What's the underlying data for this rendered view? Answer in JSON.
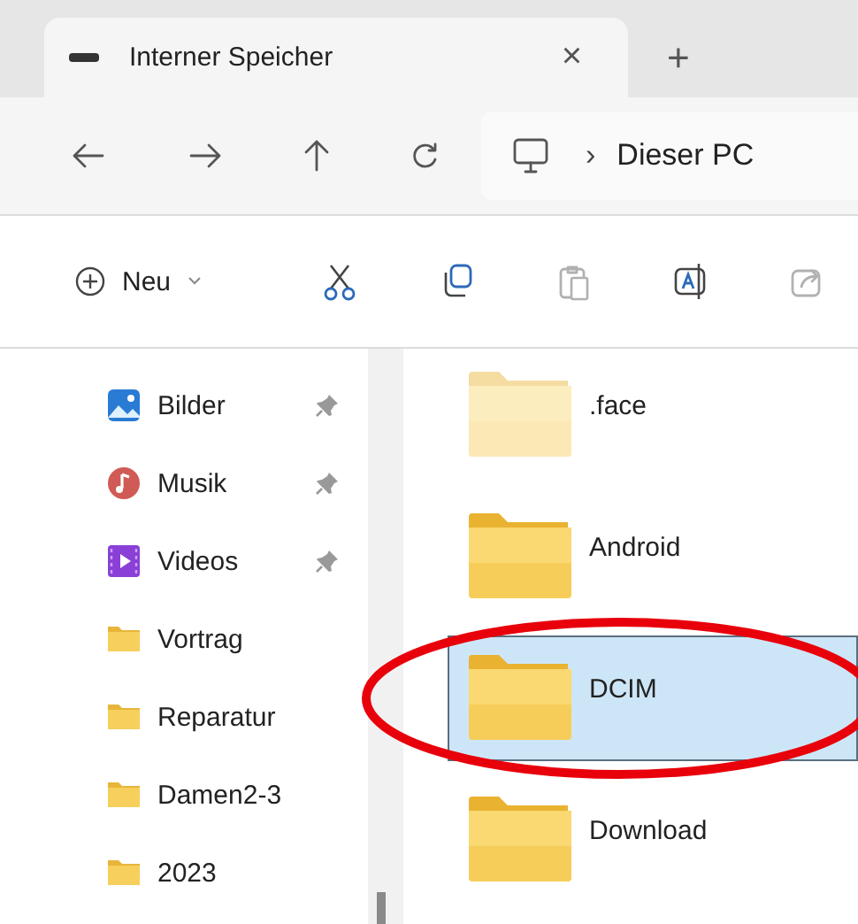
{
  "tab": {
    "title": "Interner Speicher",
    "close": "×",
    "new_tab": "+"
  },
  "navigation": {
    "address": [
      {
        "label": "Dieser PC"
      }
    ],
    "separator": "›"
  },
  "command_bar": {
    "new_button": {
      "label": "Neu"
    },
    "tools": [
      {
        "kind": "cut",
        "disabled": false
      },
      {
        "kind": "copy",
        "disabled": false
      },
      {
        "kind": "paste",
        "disabled": true
      },
      {
        "kind": "rename",
        "disabled": false
      },
      {
        "kind": "share",
        "disabled": true
      }
    ]
  },
  "sidebar": {
    "items": [
      {
        "label": "Bilder",
        "kind": "pictures",
        "pinned": true
      },
      {
        "label": "Musik",
        "kind": "music",
        "pinned": true
      },
      {
        "label": "Videos",
        "kind": "videos",
        "pinned": true
      },
      {
        "label": "Vortrag",
        "kind": "folder",
        "pinned": false
      },
      {
        "label": "Reparatur",
        "kind": "folder",
        "pinned": false
      },
      {
        "label": "Damen2-3",
        "kind": "folder",
        "pinned": false
      },
      {
        "label": "2023",
        "kind": "folder",
        "pinned": false
      }
    ]
  },
  "files": [
    {
      "name": ".face",
      "hidden": true,
      "selected": false
    },
    {
      "name": "Android",
      "hidden": false,
      "selected": false
    },
    {
      "name": "DCIM",
      "hidden": false,
      "selected": true
    },
    {
      "name": "Download",
      "hidden": false,
      "selected": false
    }
  ],
  "annotations": [
    {
      "kind": "ellipse",
      "color": "#e8000b"
    }
  ]
}
